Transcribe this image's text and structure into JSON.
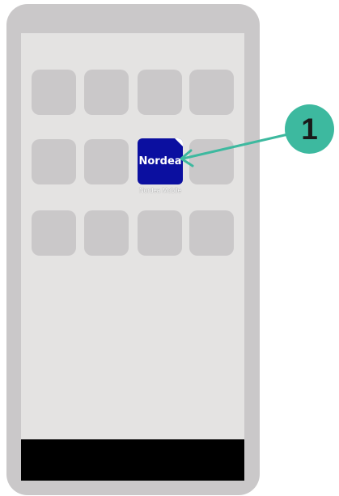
{
  "app": {
    "name": "Nordea Mobile",
    "logo_text": "Nordea",
    "icon_color": "#0b0fa0"
  },
  "callout": {
    "number": "1",
    "color": "#3db99f"
  },
  "icons": {
    "arrow": "arrow-pointer-icon"
  }
}
